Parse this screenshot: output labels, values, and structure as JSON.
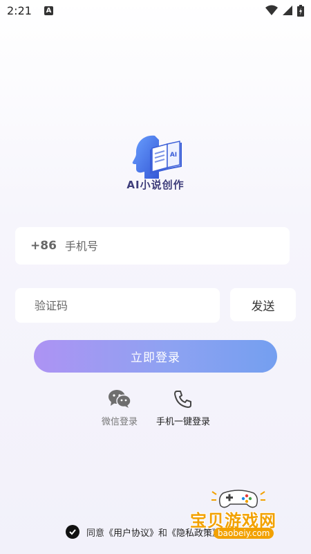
{
  "status_bar": {
    "time": "2:21",
    "notification_icon": "A"
  },
  "app": {
    "logo_text": "AI小说创作",
    "logo_badge": "AI"
  },
  "phone": {
    "country_code": "+86",
    "placeholder": "手机号",
    "value": ""
  },
  "code": {
    "placeholder": "验证码",
    "value": ""
  },
  "buttons": {
    "send": "发送",
    "login": "立即登录"
  },
  "alt_login": {
    "wechat": "微信登录",
    "phone": "手机一键登录"
  },
  "agreement": {
    "agree": "同意",
    "user_agreement": "《用户协议》",
    "and": "和",
    "privacy_policy": "《隐私政策》",
    "checked": true
  },
  "watermark": {
    "title": "宝贝游戏网",
    "url": "baobeiy.com"
  },
  "colors": {
    "login_start": "#ad93f3",
    "login_end": "#749ff0",
    "logo_blue": "#3f6fe0",
    "watermark": "#f2a100"
  },
  "icons": [
    "a-notification-icon",
    "wifi-icon",
    "signal-icon",
    "battery-icon",
    "ai-book-logo-icon",
    "wechat-icon",
    "phone-icon",
    "check-icon",
    "gamepad-icon"
  ]
}
